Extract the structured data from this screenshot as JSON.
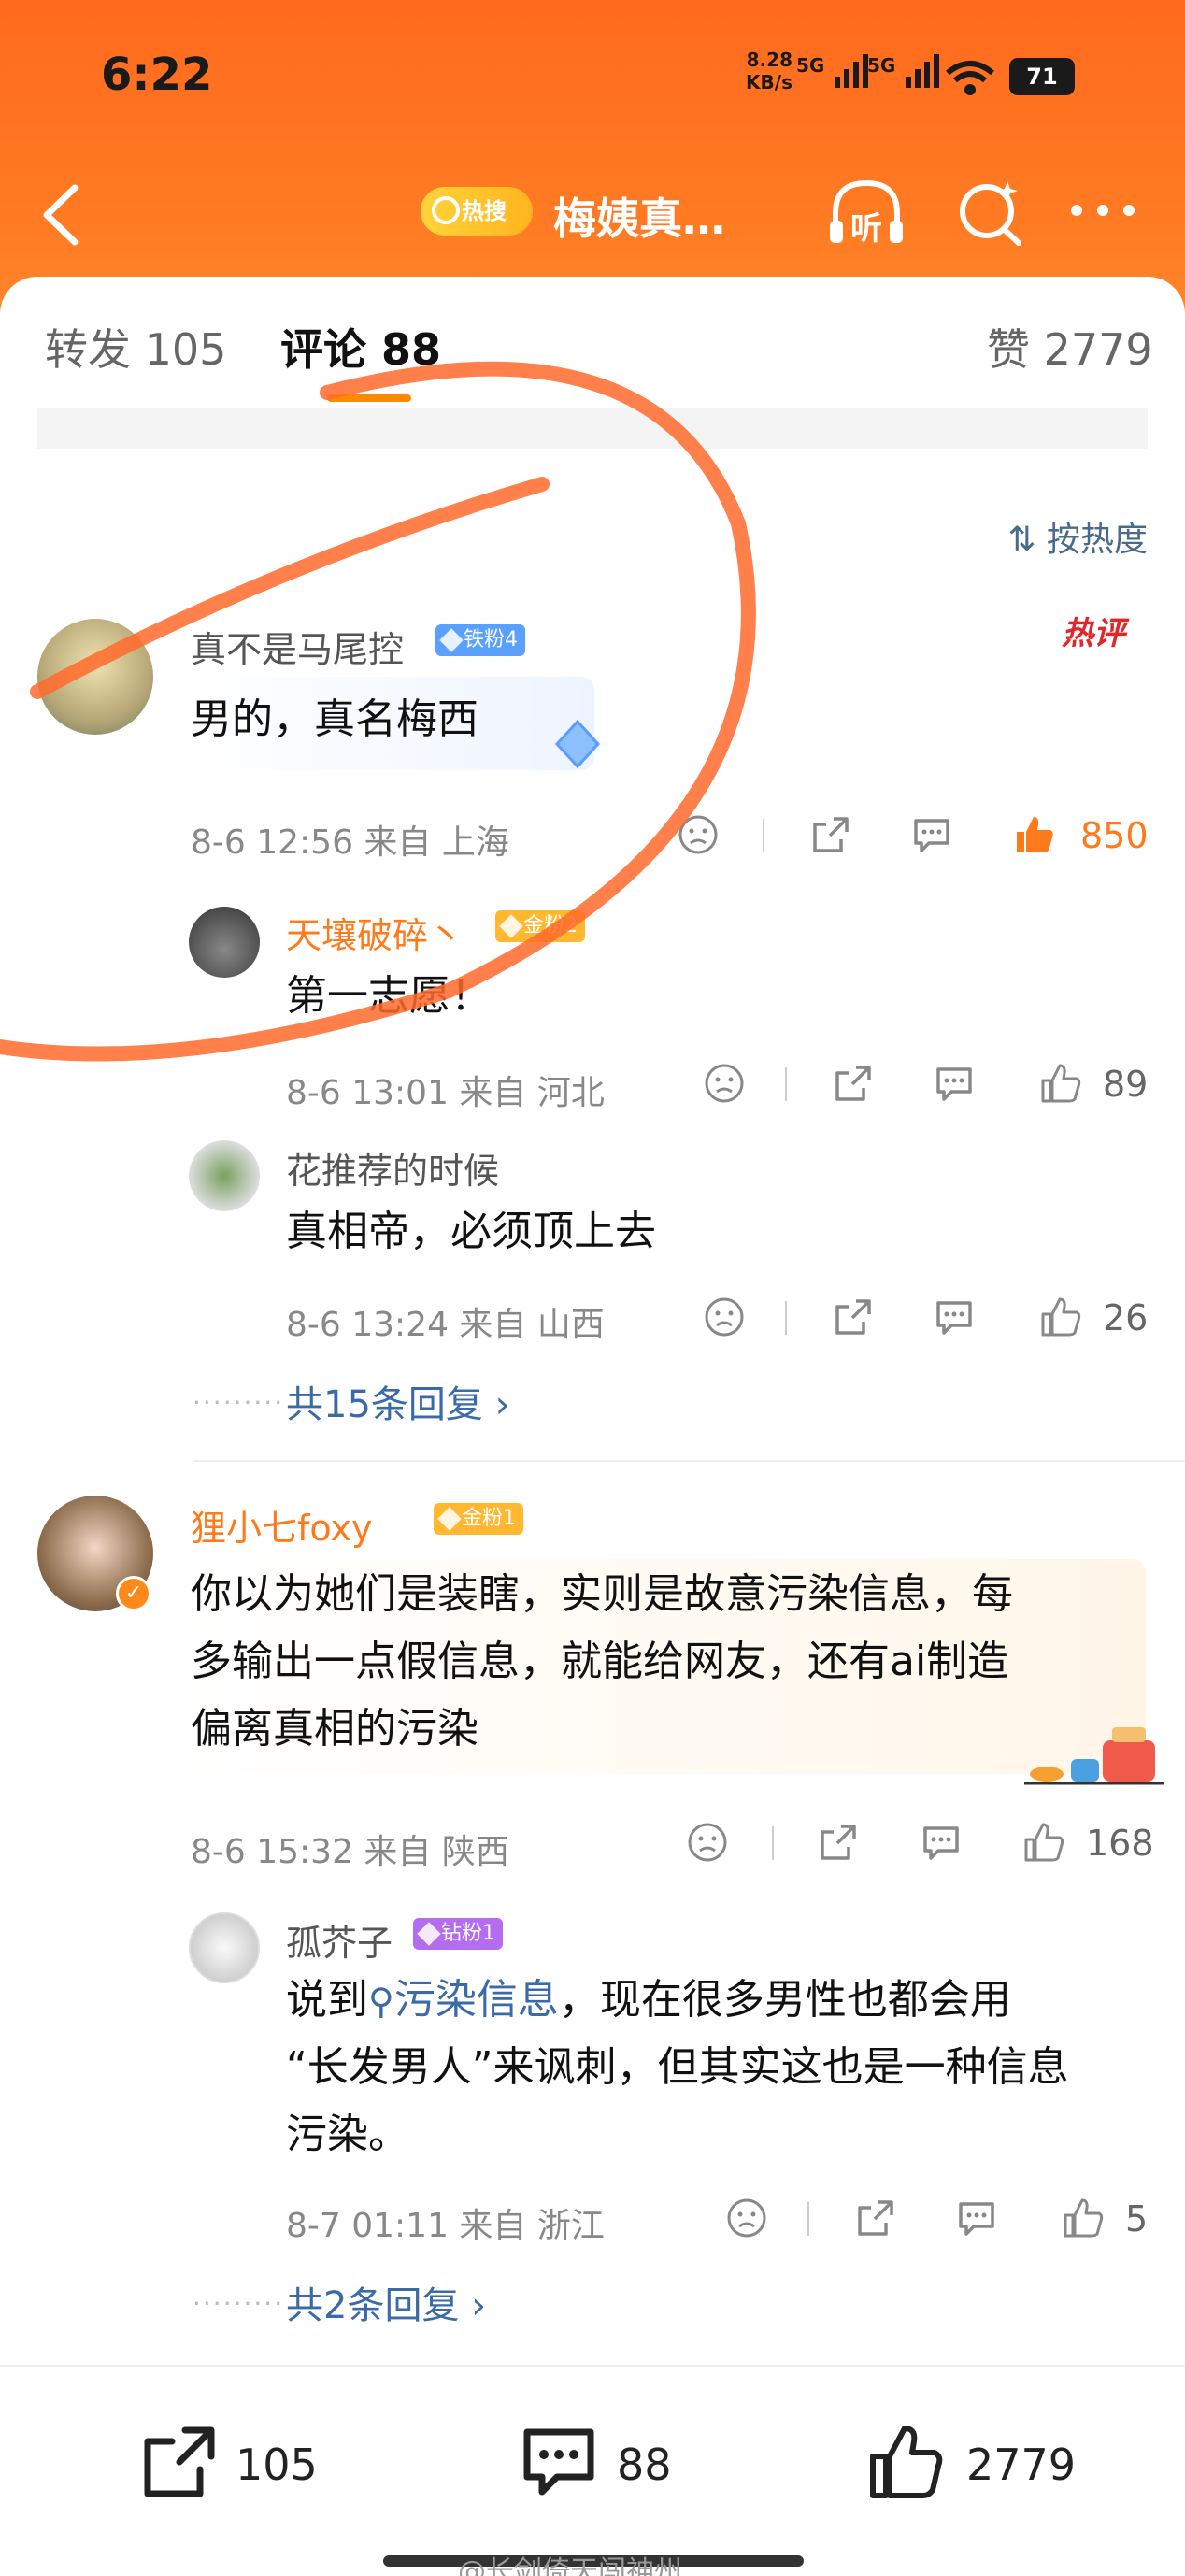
{
  "status": {
    "time": "6:22",
    "net_speed_top": "8.28",
    "net_speed_bottom": "KB/s",
    "signal1": "5G",
    "signal2": "5G",
    "battery": "71"
  },
  "nav": {
    "hot_badge": "热搜",
    "title": "梅姨真…",
    "listen_label": "听"
  },
  "tabs": {
    "repost": "转发 105",
    "comment": "评论 88",
    "like": "赞 2779"
  },
  "sort_label": "按热度",
  "comments": [
    {
      "user": "真不是马尾控",
      "badge": "铁粉4",
      "hot": "热评",
      "text": "男的，真名梅西",
      "meta": "8-6 12:56  来自 上海",
      "likes": "850",
      "replies": [
        {
          "user": "天壤破碎丶",
          "badge": "金粉2",
          "text": "第一志愿！",
          "meta": "8-6 13:01  来自 河北",
          "likes": "89"
        },
        {
          "user": "花推荐的时候",
          "text": "真相帝，必须顶上去",
          "meta": "8-6 13:24  来自 山西",
          "likes": "26"
        }
      ],
      "more_replies": "共15条回复 ›"
    },
    {
      "user": "狸小七foxy",
      "badge": "金粉1",
      "text_line1": "你以为她们是装瞎，实则是故意污染信息，每",
      "text_line2": "多输出一点假信息，就能给网友，还有ai制造",
      "text_line3": "偏离真相的污染",
      "meta": "8-6 15:32  来自 陕西",
      "likes": "168",
      "replies": [
        {
          "user": "孤芥子",
          "badge": "钻粉1",
          "text_prefix": "说到",
          "text_link": "污染信息",
          "text_line1_rest": "，现在很多男性也都会用",
          "text_line2": "“长发男人”来讽刺，但其实这也是一种信息",
          "text_line3": "污染。",
          "meta": "8-7 01:11  来自 浙江",
          "likes": "5"
        }
      ],
      "more_replies": "共2条回复 ›"
    }
  ],
  "bottom": {
    "repost": "105",
    "comment": "88",
    "like": "2779"
  },
  "watermark": "@长剑倚天闯神州"
}
